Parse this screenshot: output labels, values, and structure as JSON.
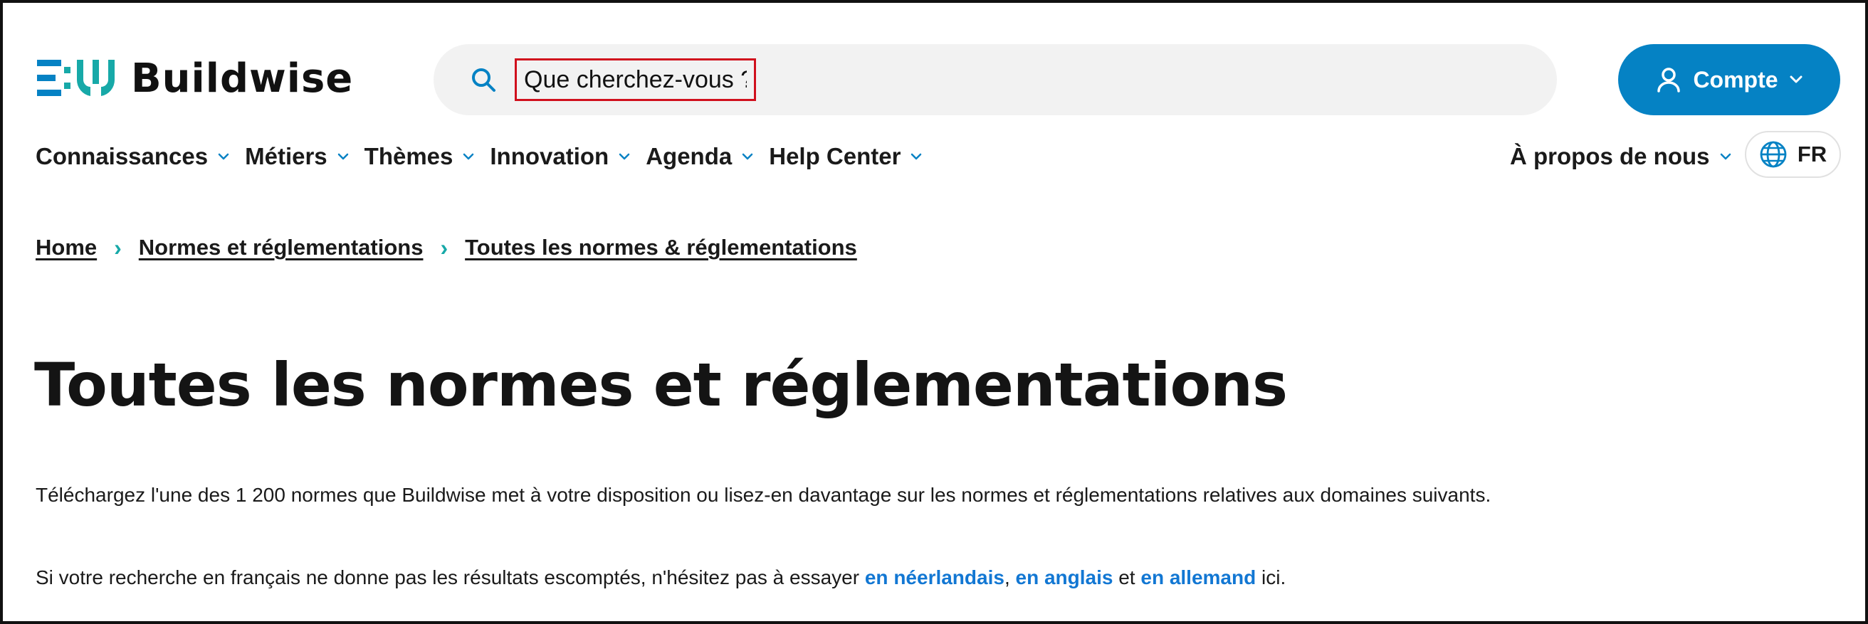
{
  "brand": {
    "name": "Buildwise",
    "colors": {
      "accent_blue": "#0582c4",
      "teal": "#17a9a8",
      "link": "#1277d3",
      "search_border": "#d0101d"
    }
  },
  "search": {
    "placeholder": "Que cherchez-vous ?",
    "icon": "search-icon"
  },
  "account": {
    "label": "Compte",
    "icon": "user-icon"
  },
  "nav": {
    "items": [
      {
        "label": "Connaissances"
      },
      {
        "label": "Métiers"
      },
      {
        "label": "Thèmes"
      },
      {
        "label": "Innovation"
      },
      {
        "label": "Agenda"
      },
      {
        "label": "Help Center"
      }
    ],
    "about_label": "À propos de nous",
    "language": {
      "label": "FR",
      "icon": "globe-icon"
    }
  },
  "breadcrumb": [
    {
      "label": "Home"
    },
    {
      "label": "Normes et réglementations"
    },
    {
      "label": "Toutes les normes & réglementations"
    }
  ],
  "page": {
    "title": "Toutes les normes et réglementations",
    "intro": "Téléchargez l'une des 1 200 normes que Buildwise met à votre disposition ou lisez-en davantage sur les normes et réglementations relatives aux domaines suivants.",
    "lang_note": {
      "prefix": "Si votre recherche en français ne donne pas les résultats escomptés, n'hésitez pas à essayer ",
      "link_nl": "en néerlandais",
      "sep1": ", ",
      "link_en": "en anglais",
      "sep2": " et ",
      "link_de": "en allemand",
      "suffix": " ici."
    }
  }
}
